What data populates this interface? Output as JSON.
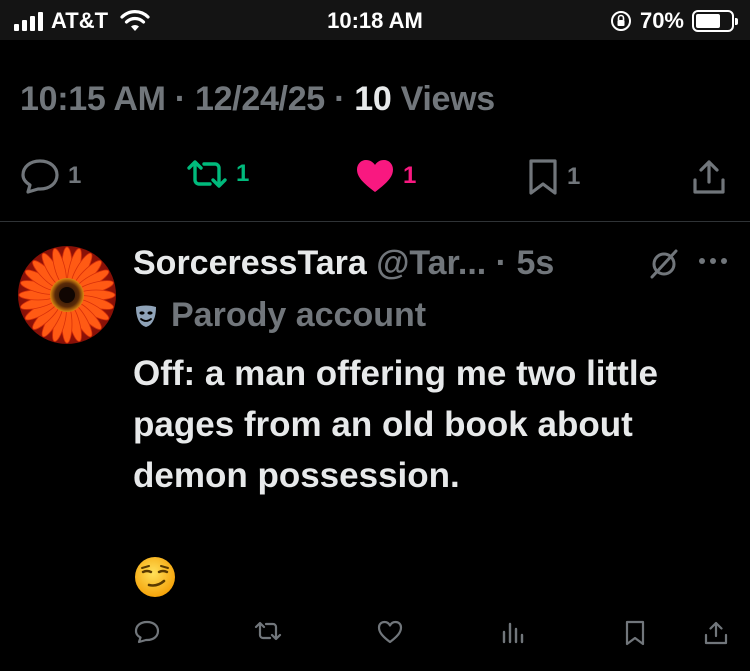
{
  "status_bar": {
    "carrier": "AT&T",
    "time": "10:18 AM",
    "battery_percent": "70%",
    "battery_level": 0.7
  },
  "tweet_meta": {
    "time": "10:15 AM",
    "separator": "·",
    "date": "12/24/25",
    "views_count": "10",
    "views_label": "Views"
  },
  "actions": {
    "replies": "1",
    "reposts": "1",
    "likes": "1",
    "bookmarks": "1"
  },
  "reply": {
    "display_name": "SorceressTara",
    "handle": "@Tar...",
    "time_ago": "· 5s",
    "label": "Parody account",
    "text": "Off: a man offering me two little pages from an old book about demon possession.",
    "emoji": "😏"
  },
  "colors": {
    "background": "#000000",
    "muted": "#71767b",
    "text": "#e7e9ea",
    "repost_active": "#00ba7c",
    "like_active": "#f91880"
  }
}
